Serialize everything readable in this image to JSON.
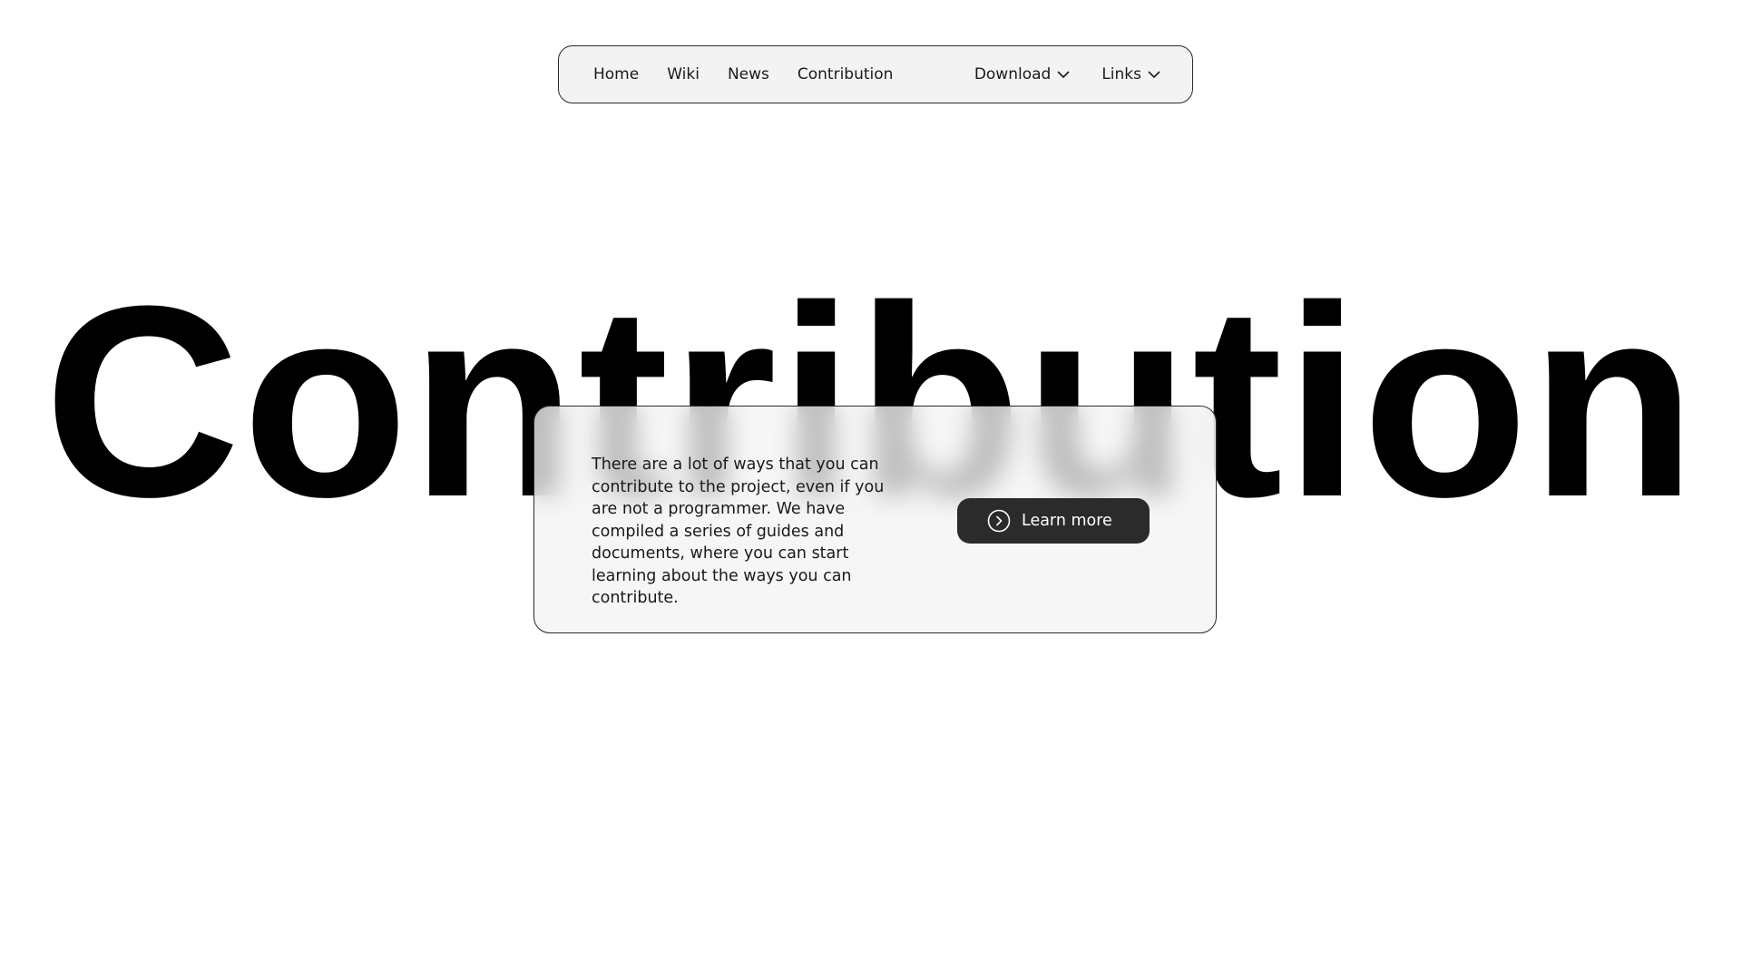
{
  "nav": {
    "left_links": [
      "Home",
      "Wiki",
      "News",
      "Contribution"
    ],
    "right_links": [
      "Download",
      "Links"
    ],
    "dropdown_icon": "chevron-down-icon"
  },
  "hero": {
    "title": "Contribution"
  },
  "card": {
    "description": "There are a lot of ways that you can contribute to the project, even if you are not a programmer. We have compiled a series of guides and documents, where you can start learning about the ways you can contribute.",
    "button_label": "Learn more",
    "button_icon": "circle-chevron-right-icon"
  },
  "colors": {
    "background": "#ffffff",
    "text": "#1a1a1a",
    "surface": "#f3f3f3",
    "button": "#2b2b2b",
    "hero": "#000000"
  }
}
